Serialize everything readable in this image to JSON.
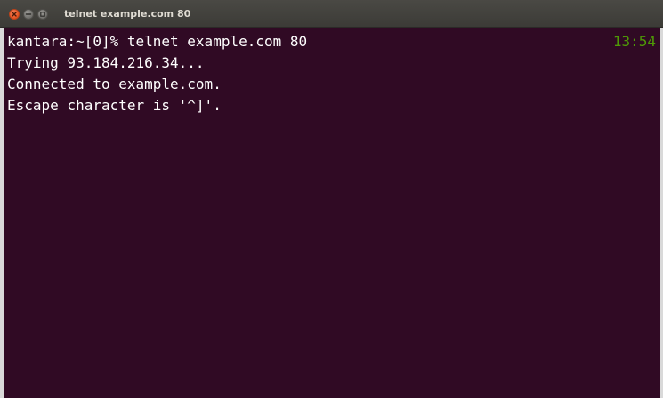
{
  "window": {
    "title": "telnet example.com 80"
  },
  "terminal": {
    "lines": [
      "kantara:~[0]% telnet example.com 80",
      "Trying 93.184.216.34...",
      "Connected to example.com.",
      "Escape character is '^]'."
    ],
    "clock": "13:54"
  },
  "colors": {
    "background": "#300a24",
    "text": "#ffffff",
    "clock": "#4e9a06",
    "close_button": "#e5511f",
    "titlebar": "#3c3b37"
  },
  "icons": {
    "close": "close-icon",
    "minimize": "minimize-icon",
    "maximize": "maximize-icon"
  }
}
